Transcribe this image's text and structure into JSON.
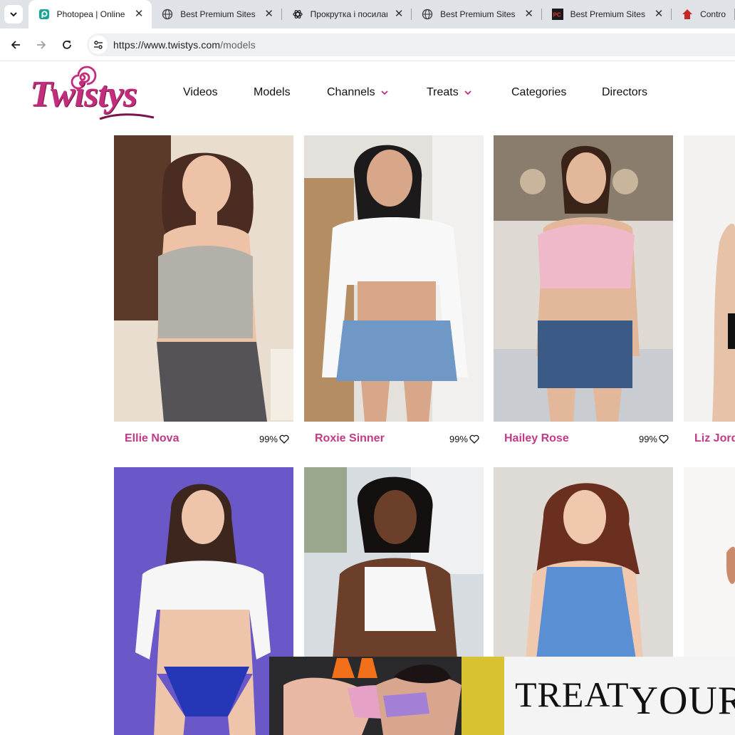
{
  "browser": {
    "tabs": [
      {
        "title": "Photopea | Online Ph",
        "icon": "photopea-icon",
        "active": true
      },
      {
        "title": "Best Premium Sites –",
        "icon": "globe-icon",
        "active": false
      },
      {
        "title": "Прокрутка і посилан",
        "icon": "openai-icon",
        "active": false
      },
      {
        "title": "Best Premium Sites –",
        "icon": "globe-icon",
        "active": false
      },
      {
        "title": "Best Premium Sites –",
        "icon": "pc-icon",
        "active": false
      },
      {
        "title": "Contro",
        "icon": "house-icon",
        "active": false
      }
    ],
    "url_host": "https://www.twistys.com",
    "url_path": "/models"
  },
  "site": {
    "logo_text": "Twistys",
    "brand_color": "#c22e7c",
    "nav": [
      {
        "label": "Videos",
        "dropdown": false
      },
      {
        "label": "Models",
        "dropdown": false
      },
      {
        "label": "Channels",
        "dropdown": true
      },
      {
        "label": "Treats",
        "dropdown": true
      },
      {
        "label": "Categories",
        "dropdown": false
      },
      {
        "label": "Directors",
        "dropdown": false
      }
    ]
  },
  "models": [
    {
      "name": "Ellie Nova",
      "rating": "99%"
    },
    {
      "name": "Roxie Sinner",
      "rating": "99%"
    },
    {
      "name": "Hailey Rose",
      "rating": "99%"
    },
    {
      "name": "Liz Jord",
      "rating": ""
    },
    {
      "name": "",
      "rating": ""
    },
    {
      "name": "",
      "rating": ""
    },
    {
      "name": "",
      "rating": ""
    },
    {
      "name": "",
      "rating": ""
    }
  ],
  "ad": {
    "word1": "TREAT",
    "word2": "YOUR"
  }
}
